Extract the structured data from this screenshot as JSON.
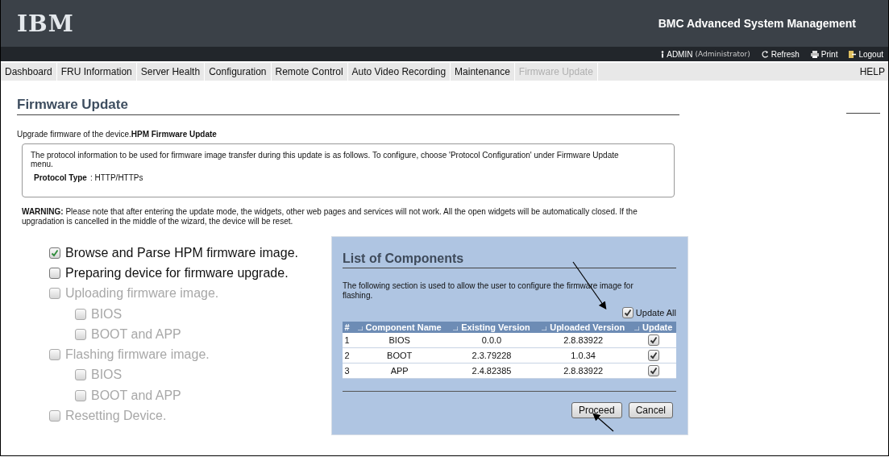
{
  "header": {
    "logo": "IBM",
    "title": "BMC Advanced System Management"
  },
  "user_bar": {
    "user": "ADMIN",
    "role": "(Administrator)",
    "links": [
      {
        "label": "Refresh",
        "kind": "refresh"
      },
      {
        "label": "Print",
        "kind": "print"
      },
      {
        "label": "Logout",
        "kind": "logout"
      }
    ]
  },
  "nav": {
    "items": [
      {
        "label": "Dashboard",
        "selected": false
      },
      {
        "label": "FRU Information",
        "selected": false
      },
      {
        "label": "Server Health",
        "selected": false
      },
      {
        "label": "Configuration",
        "selected": false
      },
      {
        "label": "Remote Control",
        "selected": false
      },
      {
        "label": "Auto Video Recording",
        "selected": false
      },
      {
        "label": "Maintenance",
        "selected": false
      },
      {
        "label": "Firmware Update",
        "selected": true
      }
    ],
    "help": "HELP"
  },
  "page": {
    "title": "Firmware Update",
    "intro": "Upgrade firmware of the device.**HPM Firmware Update**",
    "info": {
      "text": "The protocol information to be used for firmware image transfer during this update is as follows. To configure, choose 'Protocol Configuration' under Firmware Update menu.",
      "label": "Protocol Type",
      "value": ": HTTP/HTTPs"
    },
    "warning": "**WARNING:** Please note that after entering the update mode, the widgets, other web pages and services will not work. All the open widgets will be automatically closed. If the upgradation is cancelled in the middle of the wizard, the device will be reset."
  },
  "steps": [
    {
      "label": "Browse and Parse HPM firmware image.",
      "checked": true,
      "disabled": false
    },
    {
      "label": "Preparing device for firmware upgrade.",
      "checked": false,
      "disabled": false
    },
    {
      "label": "Uploading firmware image.",
      "checked": false,
      "disabled": true,
      "children": [
        {
          "label": "BIOS",
          "checked": false,
          "disabled": true
        },
        {
          "label": "BOOT and APP",
          "checked": false,
          "disabled": true
        }
      ]
    },
    {
      "label": "Flashing firmware image.",
      "checked": false,
      "disabled": true,
      "children": [
        {
          "label": "BIOS",
          "checked": false,
          "disabled": true
        },
        {
          "label": "BOOT and APP",
          "checked": false,
          "disabled": true
        }
      ]
    },
    {
      "label": "Resetting Device.",
      "checked": false,
      "disabled": true
    }
  ],
  "dialog": {
    "title": "List of Components",
    "description": "The following section is used to allow the user to configure the firmware image for flashing.",
    "update_all": {
      "label": "Update All",
      "checked": true
    },
    "columns": [
      "#",
      "Component Name",
      "Existing Version",
      "Uploaded Version",
      "Update"
    ],
    "rows": [
      {
        "number": "1",
        "name": "BIOS",
        "existing": "0.0.0",
        "uploaded": "2.8.83922",
        "update": true
      },
      {
        "number": "2",
        "name": "BOOT",
        "existing": "2.3.79228",
        "uploaded": "1.0.34",
        "update": true
      },
      {
        "number": "3",
        "name": "APP",
        "existing": "2.4.82385",
        "uploaded": "2.8.83922",
        "update": true
      }
    ],
    "buttons": [
      "Proceed",
      "Cancel"
    ]
  }
}
